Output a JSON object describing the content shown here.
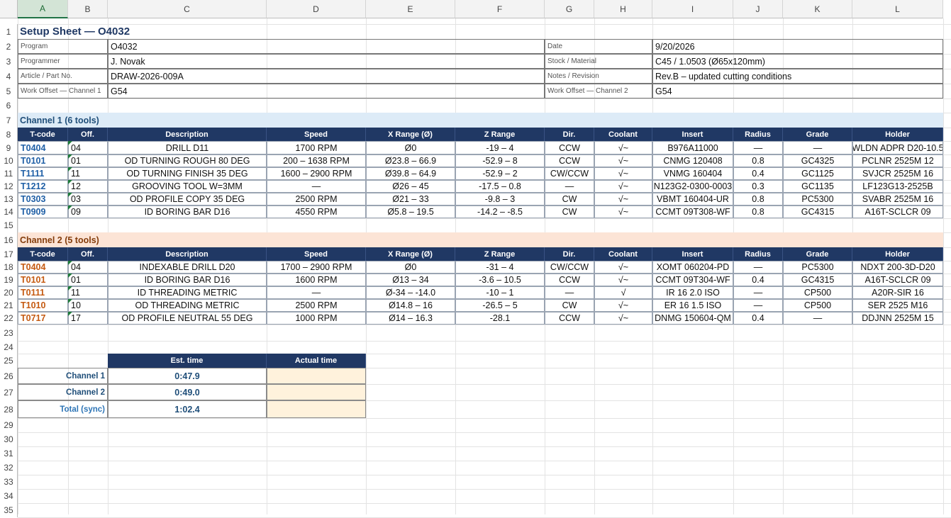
{
  "columns": [
    "A",
    "B",
    "C",
    "D",
    "E",
    "F",
    "G",
    "H",
    "I",
    "J",
    "K",
    "L"
  ],
  "rows": [
    "1",
    "2",
    "3",
    "4",
    "5",
    "6",
    "7",
    "8",
    "9",
    "10",
    "11",
    "12",
    "13",
    "14",
    "15",
    "16",
    "17",
    "18",
    "19",
    "20",
    "21",
    "22",
    "23",
    "24",
    "25",
    "26",
    "27",
    "28",
    "29",
    "30",
    "31",
    "32",
    "33",
    "34",
    "35"
  ],
  "title": "Setup Sheet — O4032",
  "info": {
    "program_label": "Program",
    "program": "O4032",
    "programmer_label": "Programmer",
    "programmer": "J. Novak",
    "article_label": "Article / Part No.",
    "article": "DRAW-2026-009A",
    "wo1_label": "Work Offset — Channel 1",
    "wo1": "G54",
    "date_label": "Date",
    "date": "9/20/2026",
    "stock_label": "Stock / Material",
    "stock": "C45 / 1.0503 (Ø65x120mm)",
    "notes_label": "Notes / Revision",
    "notes": "Rev.B – updated cutting conditions",
    "wo2_label": "Work Offset — Channel 2",
    "wo2": "G54"
  },
  "headers": [
    "T-code",
    "Off.",
    "Description",
    "Speed",
    "X Range (Ø)",
    "Z Range",
    "Dir.",
    "Coolant",
    "Insert",
    "Radius",
    "Grade",
    "Holder"
  ],
  "channel1": {
    "title": "Channel 1 (6 tools)",
    "tools": [
      [
        "T0404",
        "04",
        "DRILL D11",
        "1700 RPM",
        "Ø0",
        "-19 – 4",
        "CCW",
        "√~",
        "B976A11000",
        "—",
        "—",
        "WLDN ADPR D20-10.5"
      ],
      [
        "T0101",
        "01",
        "OD TURNING ROUGH 80 DEG",
        "200 – 1638 RPM",
        "Ø23.8 – 66.9",
        "-52.9 – 8",
        "CCW",
        "√~",
        "CNMG 120408",
        "0.8",
        "GC4325",
        "PCLNR 2525M 12"
      ],
      [
        "T1111",
        "11",
        "OD TURNING FINISH 35 DEG",
        "1600 – 2900 RPM",
        "Ø39.8 – 64.9",
        "-52.9 – 2",
        "CW/CCW",
        "√~",
        "VNMG 160404",
        "0.4",
        "GC1125",
        "SVJCR 2525M 16"
      ],
      [
        "T1212",
        "12",
        "GROOVING TOOL W=3MM",
        "—",
        "Ø26 – 45",
        "-17.5 – 0.8",
        "—",
        "√~",
        "N123G2-0300-0003",
        "0.3",
        "GC1135",
        "LF123G13-2525B"
      ],
      [
        "T0303",
        "03",
        "OD PROFILE COPY 35 DEG",
        "2500 RPM",
        "Ø21 – 33",
        "-9.8 – 3",
        "CW",
        "√~",
        "VBMT 160404-UR",
        "0.8",
        "PC5300",
        "SVABR 2525M 16"
      ],
      [
        "T0909",
        "09",
        "ID BORING BAR D16",
        "4550 RPM",
        "Ø5.8 – 19.5",
        "-14.2 – -8.5",
        "CW",
        "√~",
        "CCMT 09T308-WF",
        "0.8",
        "GC4315",
        "A16T-SCLCR 09"
      ]
    ]
  },
  "channel2": {
    "title": "Channel 2 (5 tools)",
    "tools": [
      [
        "T0404",
        "04",
        "INDEXABLE DRILL D20",
        "1700 – 2900 RPM",
        "Ø0",
        "-31 – 4",
        "CW/CCW",
        "√~",
        "XOMT 060204-PD",
        "—",
        "PC5300",
        "NDXT 200-3D-D20"
      ],
      [
        "T0101",
        "01",
        "ID BORING BAR D16",
        "1600 RPM",
        "Ø13 – 34",
        "-3.6 – 10.5",
        "CCW",
        "√~",
        "CCMT 09T304-WF",
        "0.4",
        "GC4315",
        "A16T-SCLCR 09"
      ],
      [
        "T0111",
        "11",
        "ID THREADING METRIC",
        "—",
        "Ø-34 – -14.0",
        "-10 – 1",
        "—",
        "√",
        "IR 16 2.0 ISO",
        "—",
        "CP500",
        "A20R-SIR 16"
      ],
      [
        "T1010",
        "10",
        "OD THREADING METRIC",
        "2500 RPM",
        "Ø14.8 – 16",
        "-26.5 – 5",
        "CW",
        "√~",
        "ER 16 1.5 ISO",
        "—",
        "CP500",
        "SER 2525 M16"
      ],
      [
        "T0717",
        "17",
        "OD PROFILE NEUTRAL 55 DEG",
        "1000 RPM",
        "Ø14 – 16.3",
        "-28.1",
        "CCW",
        "√~",
        "DNMG 150604-QM",
        "0.4",
        "—",
        "DDJNN 2525M 15"
      ]
    ]
  },
  "summary": {
    "est_label": "Est. time",
    "actual_label": "Actual time",
    "rows": [
      {
        "label": "Channel 1",
        "est": "0:47.9",
        "actual": ""
      },
      {
        "label": "Channel 2",
        "est": "0:49.0",
        "actual": ""
      },
      {
        "label": "Total (sync)",
        "est": "1:02.4",
        "actual": ""
      }
    ]
  },
  "colors": {
    "header_bg": "#203864",
    "channel1_band": "#ddebf7",
    "channel2_band": "#fce4d6",
    "channel1_tcode": "#1f5fa6",
    "channel2_tcode": "#c55a11",
    "actual_fill": "#fff2dc"
  }
}
